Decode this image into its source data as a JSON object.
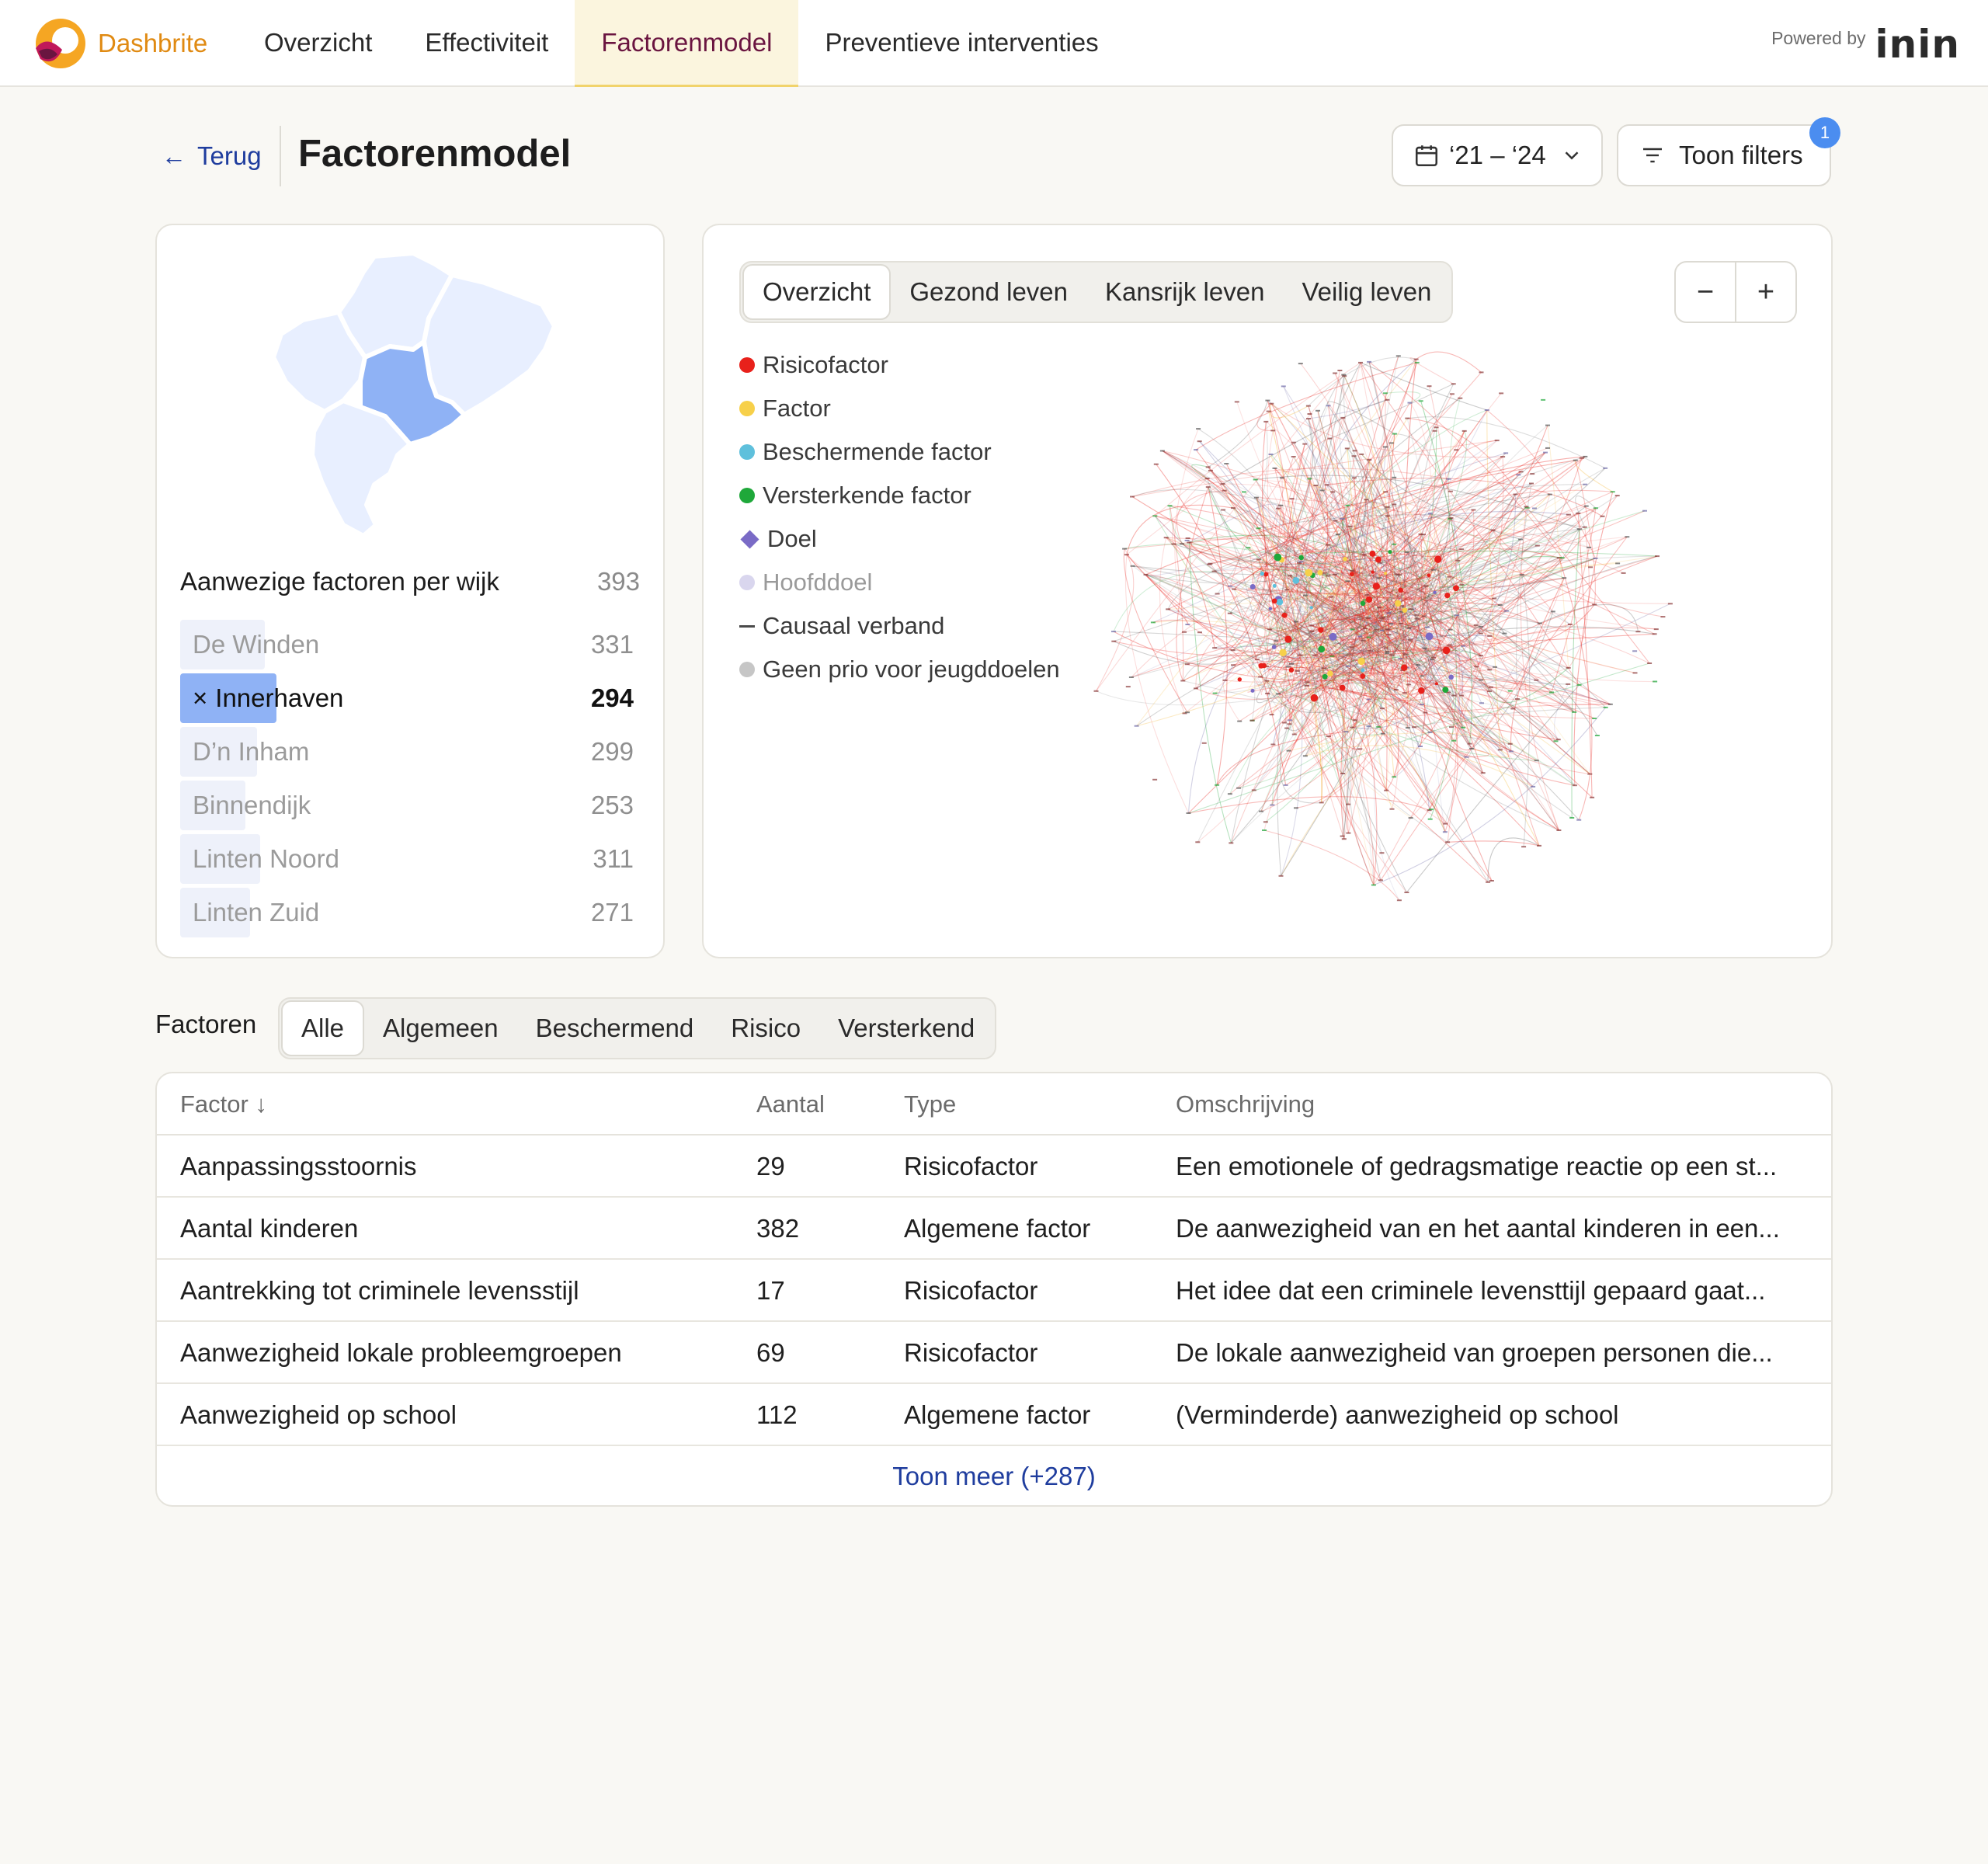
{
  "app": {
    "name": "Dashbrite",
    "powered_label": "Powered by",
    "powered_brand": "inin"
  },
  "nav": {
    "tabs": [
      {
        "label": "Overzicht"
      },
      {
        "label": "Effectiviteit"
      },
      {
        "label": "Factorenmodel",
        "active": true
      },
      {
        "label": "Preventieve interventies"
      }
    ]
  },
  "header": {
    "back_label": "Terug",
    "title": "Factorenmodel",
    "date_range": "‘21 – ‘24",
    "filters_label": "Toon filters",
    "filters_count": "1"
  },
  "map": {
    "title": "Aanwezige factoren per wijk",
    "total": "393",
    "selected_marker": "×",
    "rows": [
      {
        "name": "De Winden",
        "count": "331",
        "fraction": 0.842
      },
      {
        "name": "Innerhaven",
        "count": "294",
        "fraction": 0.748,
        "selected": true
      },
      {
        "name": "D’n Inham",
        "count": "299",
        "fraction": 0.761
      },
      {
        "name": "Binnendijk",
        "count": "253",
        "fraction": 0.644
      },
      {
        "name": "Linten Noord",
        "count": "311",
        "fraction": 0.791
      },
      {
        "name": "Linten Zuid",
        "count": "271",
        "fraction": 0.69
      }
    ]
  },
  "graph": {
    "tabs": [
      {
        "label": "Overzicht",
        "active": true
      },
      {
        "label": "Gezond leven"
      },
      {
        "label": "Kansrijk leven"
      },
      {
        "label": "Veilig leven"
      }
    ],
    "zoom_out": "−",
    "zoom_in": "+",
    "legend": [
      {
        "label": "Risicofactor",
        "shape": "dot",
        "color": "#e8211b"
      },
      {
        "label": "Factor",
        "shape": "dot",
        "color": "#f7d04a"
      },
      {
        "label": "Beschermende factor",
        "shape": "dot",
        "color": "#5fc0dc"
      },
      {
        "label": "Versterkende factor",
        "shape": "dot",
        "color": "#1fa83a"
      },
      {
        "label": "Doel",
        "shape": "diamond",
        "color": "#7a6bc6"
      },
      {
        "label": "Hoofddoel",
        "shape": "dot",
        "color": "#d9d6ee",
        "muted": true
      },
      {
        "label": "Causaal verband",
        "shape": "dash",
        "color": "#4a4a4a"
      },
      {
        "label": "Geen prio voor jeugddoelen",
        "shape": "dot",
        "color": "#c6c6c6"
      }
    ]
  },
  "factors": {
    "label": "Factoren",
    "tabs": [
      {
        "label": "Alle",
        "active": true
      },
      {
        "label": "Algemeen"
      },
      {
        "label": "Beschermend"
      },
      {
        "label": "Risico"
      },
      {
        "label": "Versterkend"
      }
    ],
    "columns": {
      "factor": "Factor ↓",
      "aantal": "Aantal",
      "type": "Type",
      "omschrijving": "Omschrijving"
    },
    "rows": [
      {
        "factor": "Aanpassingsstoornis",
        "aantal": "29",
        "type": "Risicofactor",
        "omschrijving": "Een emotionele of gedragsmatige reactie op een st..."
      },
      {
        "factor": "Aantal kinderen",
        "aantal": "382",
        "type": "Algemene factor",
        "omschrijving": "De aanwezigheid van en het aantal kinderen in een..."
      },
      {
        "factor": "Aantrekking tot criminele levensstijl",
        "aantal": "17",
        "type": "Risicofactor",
        "omschrijving": "Het idee dat een criminele levensttijl gepaard gaat..."
      },
      {
        "factor": "Aanwezigheid lokale probleemgroepen",
        "aantal": "69",
        "type": "Risicofactor",
        "omschrijving": "De lokale aanwezigheid van groepen personen die..."
      },
      {
        "factor": "Aanwezigheid op school",
        "aantal": "112",
        "type": "Algemene factor",
        "omschrijving": "(Verminderde) aanwezigheid op school"
      }
    ],
    "more_label": "Toon meer (+287)"
  }
}
